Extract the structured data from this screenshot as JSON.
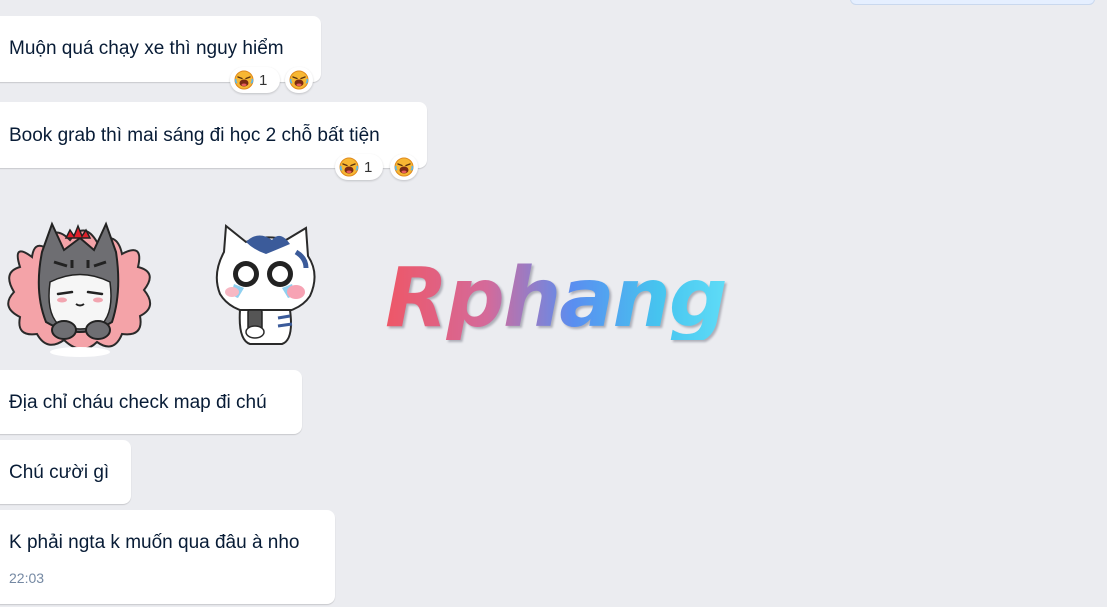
{
  "messages": [
    {
      "text": "Muộn quá chạy xe thì nguy hiểm",
      "reaction_count": "1"
    },
    {
      "text": "Book grab thì mai sáng đi học 2 chỗ bất tiện",
      "reaction_count": "1"
    },
    {
      "text": "Địa chỉ cháu check map đi chú"
    },
    {
      "text": "Chú cười gì"
    },
    {
      "text": "K phải ngta k muốn qua đâu à nho",
      "time": "22:03"
    }
  ],
  "watermark": "Rphang",
  "icons": {
    "reaction": "laughing-crying-face-icon",
    "sticker_1": "grumpy-cat-sticker",
    "sticker_2": "crying-cat-sticker"
  },
  "colors": {
    "background": "#ebecf0",
    "bubble": "#ffffff",
    "text": "#081c36",
    "time": "#7589a3"
  }
}
